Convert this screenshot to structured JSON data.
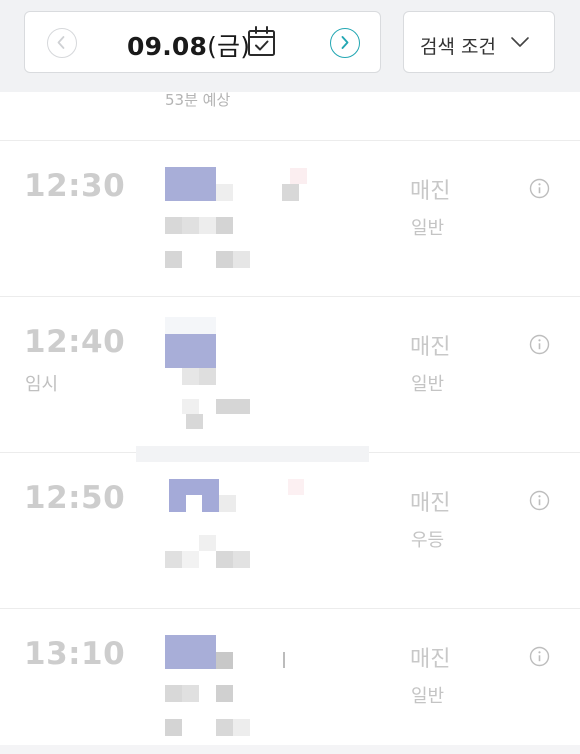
{
  "header": {
    "date": "09.08",
    "weekday": "(금)",
    "search_label": "검색 조건",
    "icons": {
      "prev": "chevron-left-icon",
      "next": "chevron-right-icon",
      "calendar": "calendar-check-icon",
      "dropdown": "chevron-down-icon"
    },
    "accent_color": "#23a7b3"
  },
  "estimate": "53분 예상",
  "schedules": [
    {
      "time": "12:30",
      "note": "",
      "status": "매진",
      "grade": "일반"
    },
    {
      "time": "12:40",
      "note": "임시",
      "status": "매진",
      "grade": "일반"
    },
    {
      "time": "12:50",
      "note": "",
      "status": "매진",
      "grade": "우등"
    },
    {
      "time": "13:10",
      "note": "",
      "status": "매진",
      "grade": "일반"
    }
  ]
}
